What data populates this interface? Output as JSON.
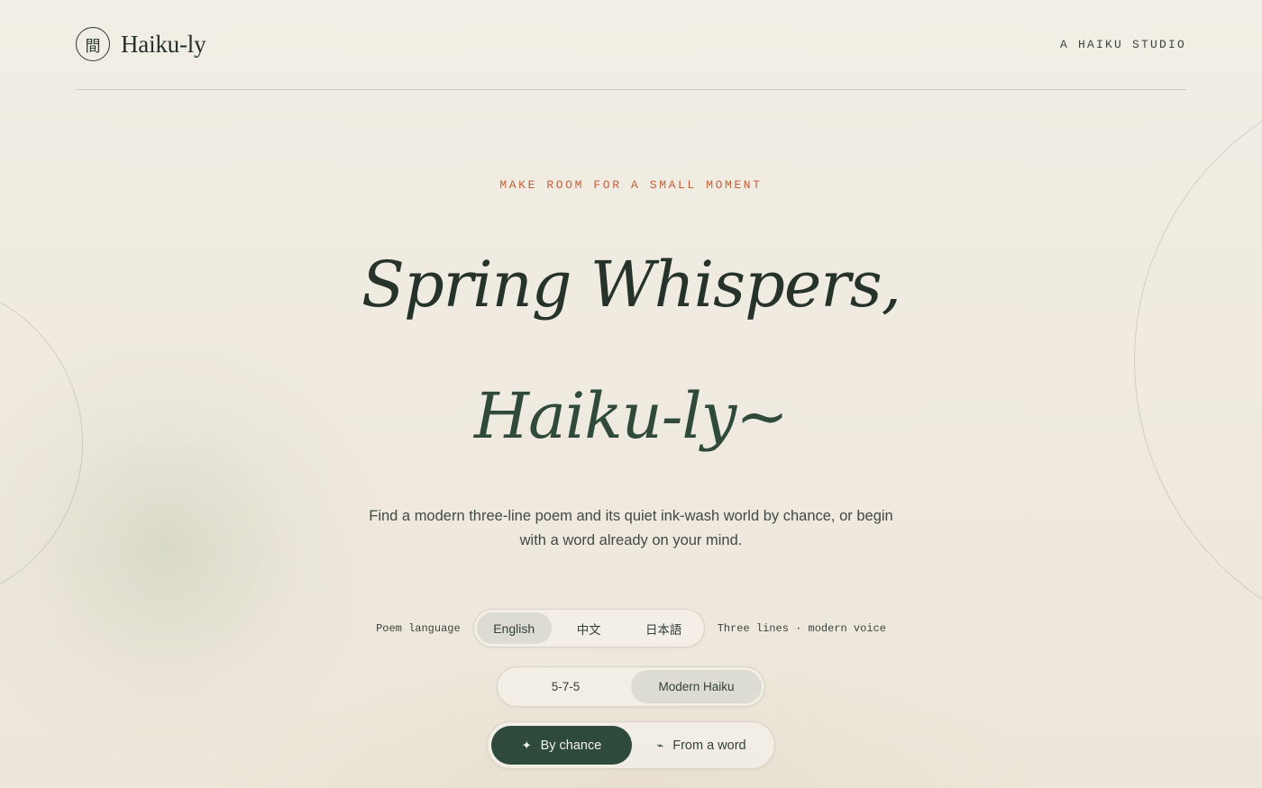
{
  "header": {
    "seal_glyph": "間",
    "brand": "Haiku-ly",
    "tagline": "A HAIKU STUDIO"
  },
  "hero": {
    "kicker": "MAKE ROOM FOR A SMALL MOMENT",
    "title_line1": "Spring Whispers,",
    "title_line2": "Haiku-ly~",
    "description": "Find a modern three-line poem and its quiet ink-wash world by chance, or begin with a word already on your mind."
  },
  "language": {
    "label": "Poem language",
    "options": [
      "English",
      "中文",
      "日本語"
    ],
    "selected": "English",
    "note": "Three lines · modern voice"
  },
  "style": {
    "options": [
      "5-7-5",
      "Modern Haiku"
    ],
    "selected": "Modern Haiku"
  },
  "mode": {
    "by_chance": "By chance",
    "by_chance_icon": "sparkle-icon",
    "from_word": "From a word",
    "from_word_icon": "tilde-icon",
    "selected": "By chance"
  },
  "colors": {
    "background": "#f1ede3",
    "accent_green": "#2e4a3d",
    "kicker_orange": "#c0603a",
    "text": "#2f3a33"
  }
}
